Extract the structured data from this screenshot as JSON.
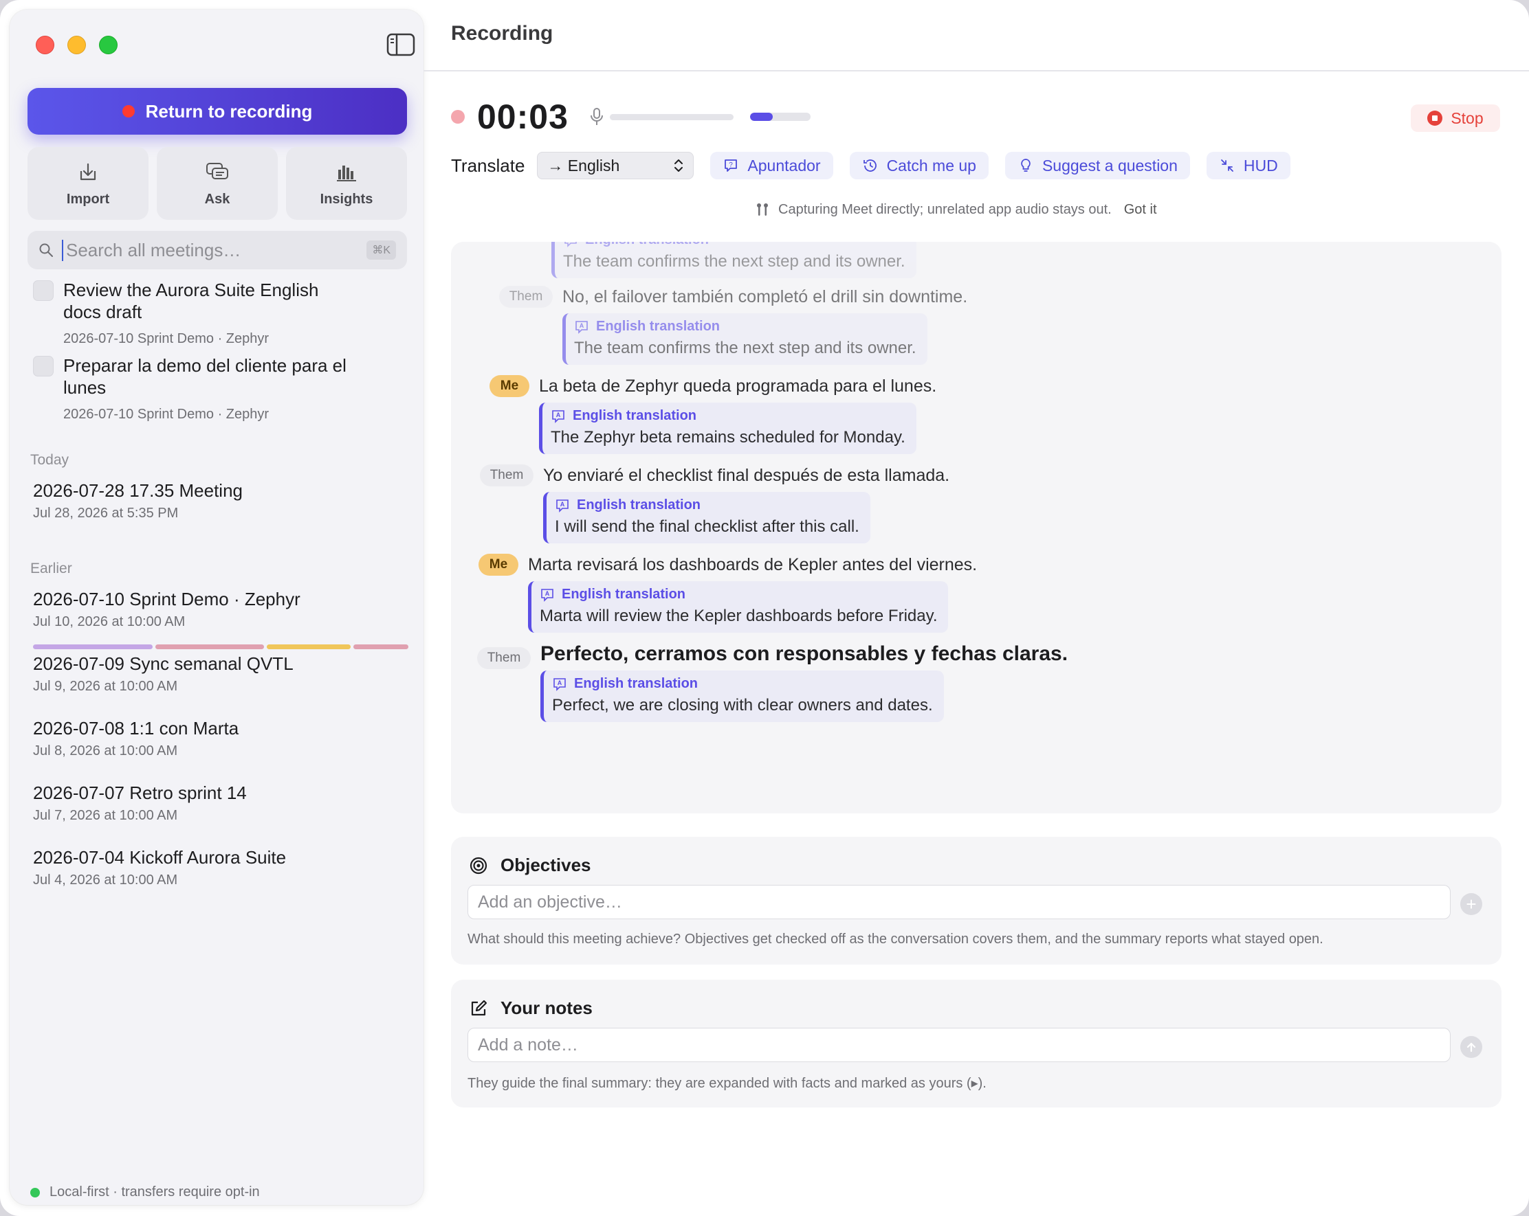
{
  "main": {
    "title": "Recording",
    "timer": "00:03",
    "level_fraction": 0.38,
    "stop_label": "Stop",
    "translate_label": "Translate",
    "language_selected": "→ English",
    "tools": {
      "apuntador": "Apuntador",
      "catch_me_up": "Catch me up",
      "suggest_question": "Suggest a question",
      "hud": "HUD"
    },
    "capture_note": "Capturing Meet directly; unrelated app audio stays out.",
    "got_it": "Got it"
  },
  "transcript": {
    "translation_label": "English translation",
    "partial_top_translation": "The team confirms the next step and its owner.",
    "utterances": [
      {
        "speaker": "Them",
        "text": "No, el failover también completó el drill sin downtime.",
        "translation": "The team confirms the next step and its owner."
      },
      {
        "speaker": "Me",
        "text": "La beta de Zephyr queda programada para el lunes.",
        "translation": "The Zephyr beta remains scheduled for Monday."
      },
      {
        "speaker": "Them",
        "text": "Yo enviaré el checklist final después de esta llamada.",
        "translation": "I will send the final checklist after this call."
      },
      {
        "speaker": "Me",
        "text": "Marta revisará los dashboards de Kepler antes del viernes.",
        "translation": "Marta will review the Kepler dashboards before Friday."
      },
      {
        "speaker": "Them",
        "text": "Perfecto, cerramos con responsables y fechas claras.",
        "translation": "Perfect, we are closing with clear owners and dates."
      }
    ]
  },
  "objectives": {
    "title": "Objectives",
    "placeholder": "Add an objective…",
    "help": "What should this meeting achieve? Objectives get checked off as the conversation covers them, and the summary reports what stayed open."
  },
  "notes": {
    "title": "Your notes",
    "placeholder": "Add a note…",
    "help": "They guide the final summary: they are expanded with facts and marked as yours (▸)."
  },
  "sidebar": {
    "return_label": "Return to recording",
    "actions": {
      "import": "Import",
      "ask": "Ask",
      "insights": "Insights"
    },
    "search_placeholder": "Search all meetings…",
    "search_shortcut": "⌘K",
    "tasks": [
      {
        "title": "Review the Aurora Suite English docs draft",
        "meta": "2026-07-10 Sprint Demo · Zephyr"
      },
      {
        "title": "Preparar la demo del cliente para el lunes",
        "meta": "2026-07-10 Sprint Demo · Zephyr"
      }
    ],
    "today_label": "Today",
    "earlier_label": "Earlier",
    "today_meetings": [
      {
        "title": "2026-07-28 17.35 Meeting",
        "date": "Jul 28, 2026 at 5:35 PM"
      }
    ],
    "earlier_meetings": [
      {
        "title": "2026-07-10 Sprint Demo · Zephyr",
        "date": "Jul 10, 2026 at 10:00 AM"
      },
      {
        "title": "2026-07-09 Sync semanal QVTL",
        "date": "Jul 9, 2026 at 10:00 AM"
      },
      {
        "title": "2026-07-08 1:1 con Marta",
        "date": "Jul 8, 2026 at 10:00 AM"
      },
      {
        "title": "2026-07-07 Retro sprint 14",
        "date": "Jul 7, 2026 at 10:00 AM"
      },
      {
        "title": "2026-07-04 Kickoff Aurora Suite",
        "date": "Jul 4, 2026 at 10:00 AM"
      }
    ],
    "tag_colors": [
      "#c4a6e6",
      "#e0a0b0",
      "#f0c65a",
      "#e0a0b0"
    ],
    "footer_status": "Local-first · transfers require opt-in"
  },
  "colors": {
    "accent": "#5b4ee6",
    "record_red": "#ff3b30",
    "stop_red": "#e5413a",
    "me_badge": "#f6c873"
  }
}
